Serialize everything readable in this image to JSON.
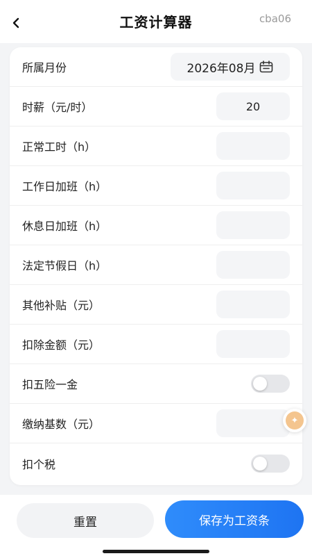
{
  "header": {
    "title": "工资计算器",
    "user_tag": "cba06"
  },
  "form": {
    "month_label": "所属月份",
    "month_value": "2026年08月",
    "hourly_wage_label": "时薪（元/时）",
    "hourly_wage_value": "20",
    "normal_hours_label": "正常工时（h）",
    "normal_hours_value": "",
    "weekday_overtime_label": "工作日加班（h）",
    "weekday_overtime_value": "",
    "restday_overtime_label": "休息日加班（h）",
    "restday_overtime_value": "",
    "holiday_label": "法定节假日（h）",
    "holiday_value": "",
    "other_allowance_label": "其他补贴（元）",
    "other_allowance_value": "",
    "deduction_label": "扣除金额（元）",
    "deduction_value": "",
    "social_insurance_label": "扣五险一金",
    "social_insurance_on": false,
    "contribution_base_label": "缴纳基数（元）",
    "contribution_base_value": "",
    "income_tax_label": "扣个税",
    "income_tax_on": false
  },
  "actions": {
    "reset_label": "重置",
    "save_label": "保存为工资条"
  },
  "colors": {
    "accent": "#1e74f2",
    "float_help": "#f4c58f"
  }
}
